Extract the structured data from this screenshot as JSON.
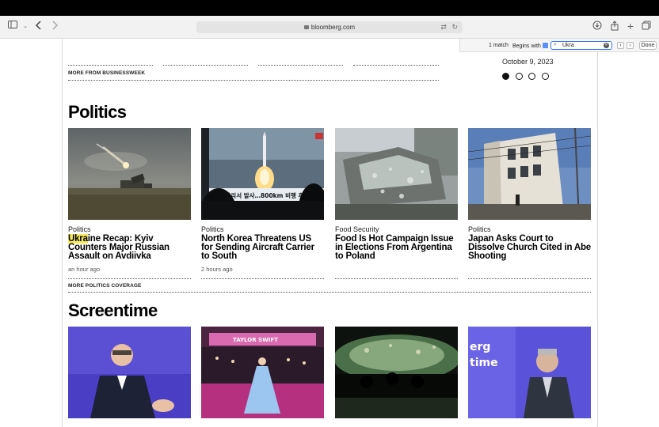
{
  "browser": {
    "url": "bloomberg.com"
  },
  "find_bar": {
    "match_count": "1 match",
    "mode_label": "Begins with",
    "query": "Ukra",
    "done_label": "Done"
  },
  "top_module": {
    "more_link": "MORE FROM BUSINESSWEEK",
    "date": "October 9, 2023",
    "carousel_dots": 4,
    "active_dot": 1
  },
  "politics": {
    "title": "Politics",
    "more_link": "MORE POLITICS COVERAGE",
    "cards": [
      {
        "kicker": "Politics",
        "headline_match": "Ukra",
        "headline_rest": "ine Recap: Kyiv Counters Major Russian Assault on Avdiivka",
        "timestamp": "an hour ago"
      },
      {
        "kicker": "Politics",
        "headline_match": "",
        "headline_rest": "North Korea Threatens US for Sending Aircraft Carrier to South",
        "timestamp": "2 hours ago"
      },
      {
        "kicker": "Food Security",
        "headline_match": "",
        "headline_rest": "Food Is Hot Campaign Issue in Elections From Argentina to Poland",
        "timestamp": ""
      },
      {
        "kicker": "Politics",
        "headline_match": "",
        "headline_rest": "Japan Asks Court to Dissolve Church Cited in Abe Shooting",
        "timestamp": ""
      }
    ]
  },
  "screentime": {
    "title": "Screentime"
  },
  "image_text": {
    "korean_banner": "북 동창리서 발사…800km 비행 후 추",
    "theatre_sign": "TAYLOR SWIFT",
    "panel_backdrop_1": "erg",
    "panel_backdrop_2": "time"
  }
}
